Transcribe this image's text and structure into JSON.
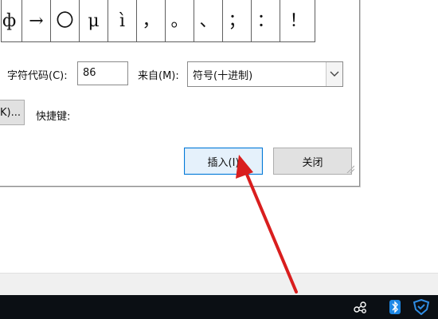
{
  "symbol_grid": [
    "ф",
    "→",
    "〇",
    "μ",
    "ì",
    "，",
    "。",
    "、",
    "；",
    "：",
    "！"
  ],
  "char_code": {
    "label": "字符代码(C):",
    "value": "86"
  },
  "from": {
    "label": "来自(M):",
    "selected": "符号(十进制)"
  },
  "shortcut": {
    "button_label": "K)...",
    "label": "快捷键:"
  },
  "buttons": {
    "insert": "插入(I)",
    "close": "关闭"
  },
  "tray": {
    "icons": [
      "network-icon",
      "bluetooth-icon",
      "security-shield-icon"
    ]
  },
  "colors": {
    "accent": "#0078d7",
    "arrow": "#d91e1e",
    "taskbar": "#0b0f14"
  }
}
